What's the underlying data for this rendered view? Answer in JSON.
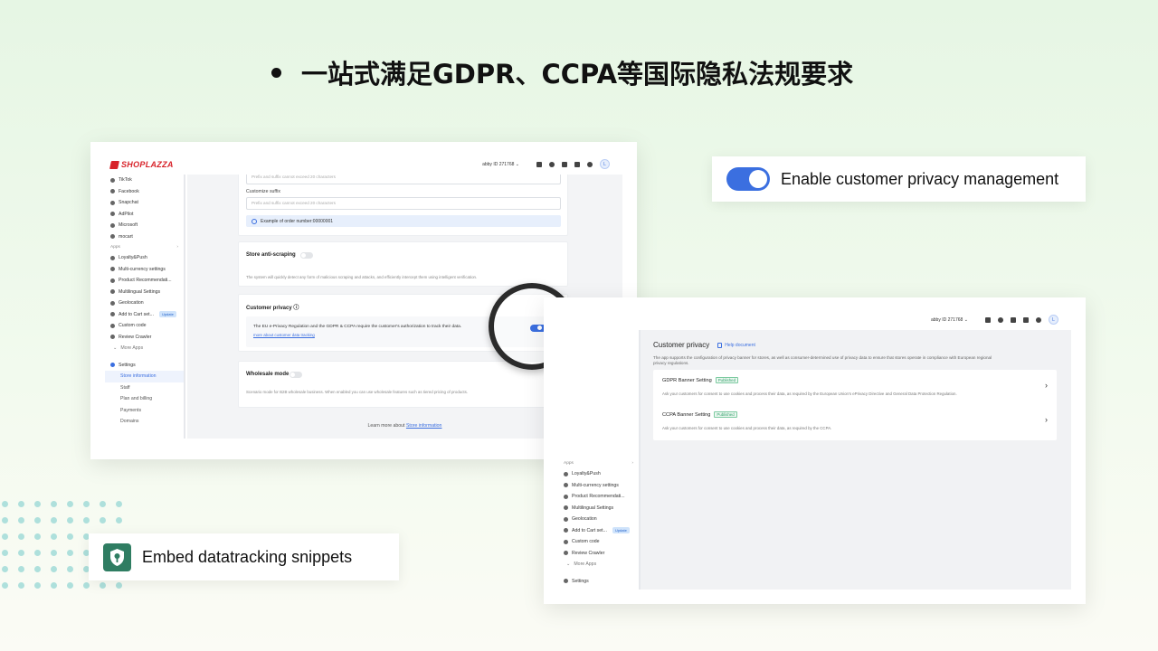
{
  "headline": "一站式满足GDPR、CCPA等国际隐私法规要求",
  "left_screenshot": {
    "logo": "SHOPLAZZA",
    "user": "abby ID 271768",
    "sidebar": {
      "channels": [
        "TikTok",
        "Facebook",
        "Snapchat",
        "AdPilot",
        "Microsoft",
        "mocart"
      ],
      "apps_label": "Apps",
      "apps": [
        "Loyalty&Push",
        "Multi-currency settings",
        "Product Recommendati...",
        "Multilingual Settings",
        "Geolocation",
        "Add to Cart set...",
        "Custom code",
        "Review Crawler"
      ],
      "update_badge": "Update",
      "more_apps": "More Apps",
      "settings": "Settings",
      "settings_sub": [
        "Store information",
        "Staff",
        "Plan and billing",
        "Payments",
        "Domains"
      ]
    },
    "order_prefix": {
      "prefix_placeholder": "Prefix and suffix cannot exceed 20 characters",
      "suffix_label": "Customize suffix",
      "suffix_placeholder": "Prefix and suffix cannot exceed 20 characters",
      "example": "Example of order number:00000001"
    },
    "anti_scraping": {
      "title": "Store anti-scraping",
      "desc": "The system will quickly detect any form of malicious scraping and attacks, and efficiently intercept them using intelligent verification."
    },
    "customer_privacy": {
      "title": "Customer privacy",
      "desc": "The EU e-Privacy Regulation and the GDPR & CCPA require the customer's authorization to track their data.",
      "link": "more about customer data tracking"
    },
    "wholesale": {
      "title": "Wholesale mode",
      "desc": "Scenario mode for B2B wholesale business. When enabled you can use wholesale features such as tiered pricing of products."
    },
    "footer_text": "Learn more about",
    "footer_link": "Store information"
  },
  "right_screenshot": {
    "user": "abby ID 271768",
    "title": "Customer privacy",
    "help": "Help document",
    "desc": "The app supports the configuration of privacy banner for stores, as well as consumer-determined use of privacy data to ensure that stores operate in compliance with European regional privacy regulations.",
    "rows": [
      {
        "name": "GDPR Banner Setting",
        "status": "Published",
        "desc": "Ask your customers for consent to use cookies and process their data, as required by the European Union's ePrivacy Directive and General Data Protection Regulation."
      },
      {
        "name": "CCPA Banner Setting",
        "status": "Published",
        "desc": "Ask your customers for consent to use cookies and process their data, as required by the CCPA."
      }
    ],
    "sidebar": {
      "apps_label": "Apps",
      "apps": [
        "Loyalty&Push",
        "Multi-currency settings",
        "Product Recommendati...",
        "Multilingual Settings",
        "Geolocation",
        "Add to Cart set...",
        "Custom code",
        "Review Crawler"
      ],
      "update_badge": "Update",
      "more_apps": "More Apps",
      "settings": "Settings"
    }
  },
  "callouts": {
    "toggle_text": "Enable customer privacy management",
    "embed_text": "Embed datatracking snippets"
  },
  "colors": {
    "accent": "#3b6fe0",
    "shield_bg": "#2f7d62",
    "brand_red": "#d8232a"
  }
}
